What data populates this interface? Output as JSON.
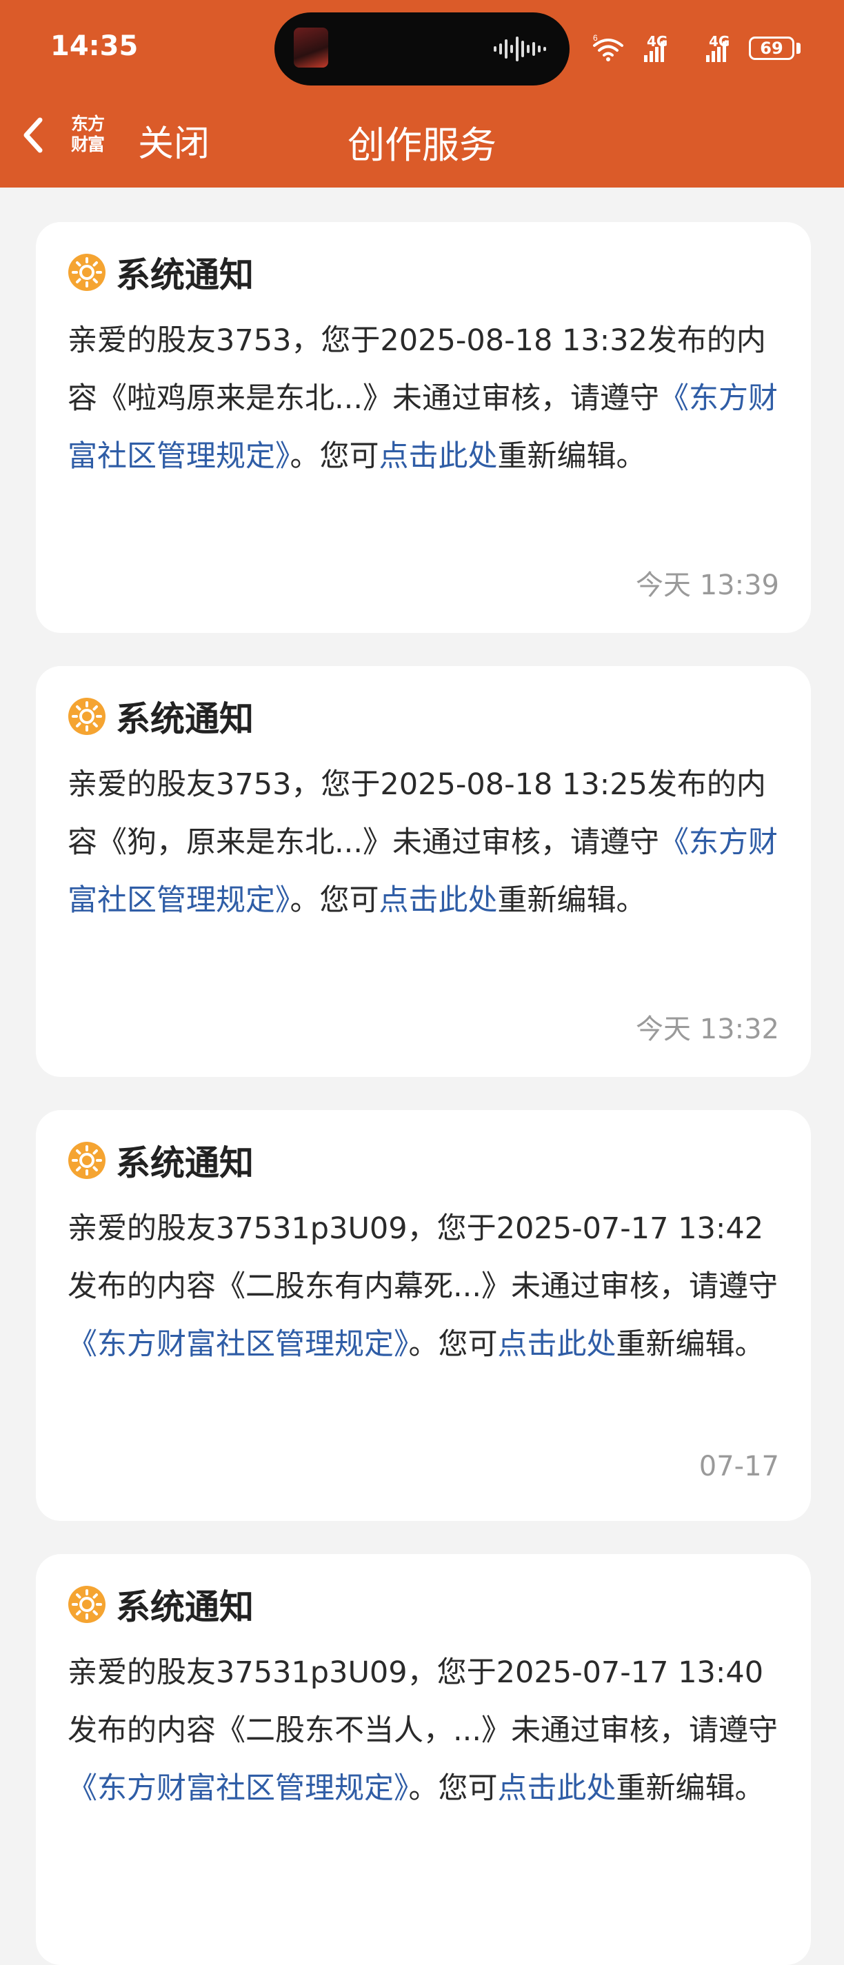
{
  "status_bar": {
    "time": "14:35",
    "battery": "69",
    "network_1": "4G",
    "network_2": "4G"
  },
  "nav": {
    "logo_line1": "东方",
    "logo_line2": "财富",
    "close_label": "关闭",
    "title": "创作服务"
  },
  "notifications": [
    {
      "title": "系统通知",
      "text_before": "亲爱的股友3753，您于2025-08-18 13:32发布的内容《啦鸡原来是东北...》未通过审核，请遵守",
      "rules_link": "《东方财富社区管理规定》",
      "text_middle": "。您可",
      "edit_link": "点击此处",
      "text_after": "重新编辑。",
      "time": "今天 13:39"
    },
    {
      "title": "系统通知",
      "text_before": "亲爱的股友3753，您于2025-08-18 13:25发布的内容《狗，原来是东北...》未通过审核，请遵守",
      "rules_link": "《东方财富社区管理规定》",
      "text_middle": "。您可",
      "edit_link": "点击此处",
      "text_after": "重新编辑。",
      "time": "今天 13:32"
    },
    {
      "title": "系统通知",
      "text_before": "亲爱的股友37531p3U09，您于2025-07-17 13:42发布的内容《二股东有内幕死...》未通过审核，请遵守",
      "rules_link": "《东方财富社区管理规定》",
      "text_middle": "。您可",
      "edit_link": "点击此处",
      "text_after": "重新编辑。",
      "time": "07-17"
    },
    {
      "title": "系统通知",
      "text_before": "亲爱的股友37531p3U09，您于2025-07-17 13:40发布的内容《二股东不当人，...》未通过审核，请遵守",
      "rules_link": "《东方财富社区管理规定》",
      "text_middle": "。您可",
      "edit_link": "点击此处",
      "text_after": "重新编辑。",
      "time": ""
    }
  ],
  "colors": {
    "header": "#db5b29",
    "link": "#2f5da6",
    "icon": "#f5a431"
  }
}
